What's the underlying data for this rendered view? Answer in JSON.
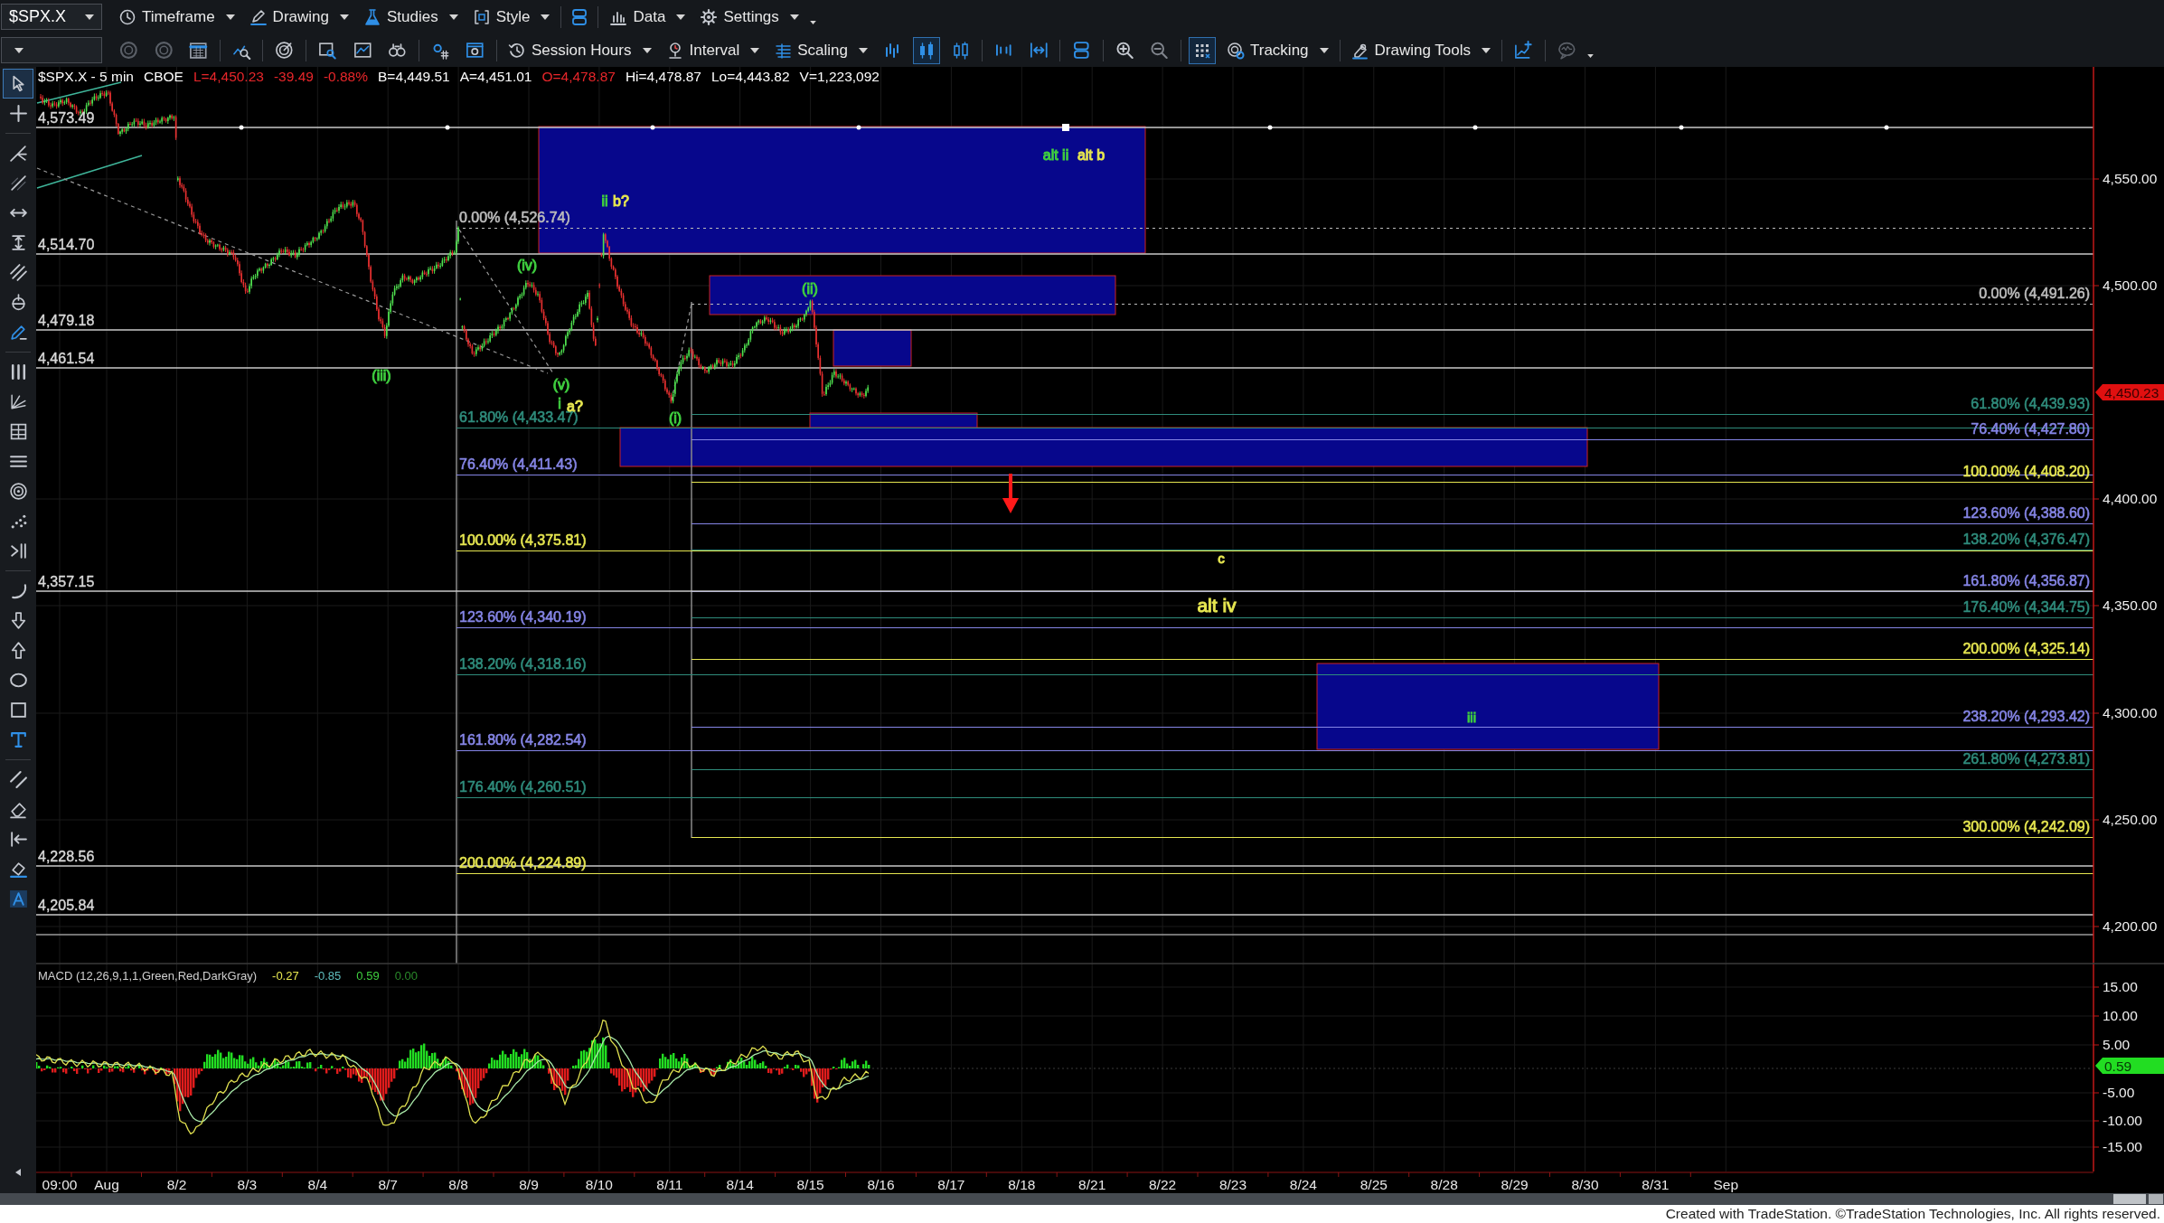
{
  "toolbar": {
    "symbol": "$SPX.X",
    "menus": [
      {
        "label": "Timeframe"
      },
      {
        "label": "Drawing"
      },
      {
        "label": "Studies"
      },
      {
        "label": "Style"
      },
      {
        "label": "Data"
      },
      {
        "label": "Settings"
      }
    ]
  },
  "toolbar_2": {
    "session_button": "Session Hours",
    "interval_button": "Interval",
    "scaling_button": "Scaling",
    "chart_styles": [
      {
        "selected": false
      },
      {
        "selected": true
      },
      {
        "selected": false
      }
    ],
    "grid_toggle": {
      "on": true
    },
    "tracking_button": "Tracking",
    "drawing_tools_button": "Drawing Tools"
  },
  "drawing_tools": [
    {
      "selected": true
    },
    {
      "selected": false
    },
    {
      "selected": false
    },
    {
      "selected": false
    },
    {
      "selected": false
    },
    {
      "selected": false
    },
    {
      "selected": false
    },
    {
      "selected": false
    },
    {
      "selected": false
    },
    {
      "selected": false
    },
    {
      "selected": false
    },
    {
      "selected": false
    },
    {
      "selected": false
    },
    {
      "selected": false
    },
    {
      "selected": false
    },
    {
      "selected": false
    },
    {
      "selected": false
    },
    {
      "selected": false
    },
    {
      "selected": false
    },
    {
      "selected": false
    },
    {
      "selected": false
    },
    {
      "selected": false
    },
    {
      "selected": false
    },
    {
      "selected": false
    },
    {
      "selected": false
    },
    {
      "selected": false
    },
    {
      "selected": false
    }
  ],
  "chart": {
    "quote": [
      {
        "text": "$SPX.X - 5 min",
        "color": "#ffffff"
      },
      {
        "text": "CBOE",
        "color": "#ffffff"
      },
      {
        "text": "L=4,450.23",
        "color": "#e8262a"
      },
      {
        "text": "-39.49",
        "color": "#e8262a"
      },
      {
        "text": "-0.88%",
        "color": "#e8262a"
      },
      {
        "text": "B=4,449.51",
        "color": "#ffffff"
      },
      {
        "text": "A=4,451.01",
        "color": "#ffffff"
      },
      {
        "text": "O=4,478.87",
        "color": "#e8262a"
      },
      {
        "text": "Hi=4,478.87",
        "color": "#ffffff"
      },
      {
        "text": "Lo=4,443.82",
        "color": "#ffffff"
      },
      {
        "text": "V=1,223,092",
        "color": "#ffffff"
      }
    ],
    "price_lines": [
      {
        "label": "4,573.49"
      },
      {
        "label": "4,514.70"
      },
      {
        "label": "4,479.18"
      },
      {
        "label": "4,461.54"
      },
      {
        "label": "4,357.15"
      },
      {
        "label": "4,228.56"
      },
      {
        "label": "4,205.84"
      }
    ],
    "fib_retracement": [
      {
        "label": "0.00% (4,526.74)",
        "color": "#bcbcbc",
        "kind": "base"
      },
      {
        "label": "61.80% (4,433.47)",
        "color": "#2f8c7c",
        "kind": "level"
      },
      {
        "label": "76.40% (4,411.43)",
        "color": "#8585e6",
        "kind": "level"
      },
      {
        "label": "100.00% (4,375.81)",
        "color": "#e6e650",
        "kind": "level"
      },
      {
        "label": "123.60% (4,340.19)",
        "color": "#8585e6",
        "kind": "level"
      },
      {
        "label": "138.20% (4,318.16)",
        "color": "#2f8c7c",
        "kind": "level"
      },
      {
        "label": "161.80% (4,282.54)",
        "color": "#8585e6",
        "kind": "level"
      },
      {
        "label": "176.40% (4,260.51)",
        "color": "#2f8c7c",
        "kind": "level"
      },
      {
        "label": "200.00% (4,224.89)",
        "color": "#e6e650",
        "kind": "level"
      }
    ],
    "fib_extension": [
      {
        "label": "0.00% (4,491.26)",
        "color": "#bcbcbc",
        "kind": "base"
      },
      {
        "label": "61.80% (4,439.93)",
        "color": "#2f8c7c",
        "kind": "level"
      },
      {
        "label": "76.40% (4,427.80)",
        "color": "#8585e6",
        "kind": "level"
      },
      {
        "label": "100.00% (4,408.20)",
        "color": "#e6e650",
        "kind": "level"
      },
      {
        "label": "123.60% (4,388.60)",
        "color": "#8585e6",
        "kind": "level"
      },
      {
        "label": "138.20% (4,376.47)",
        "color": "#2f8c7c",
        "kind": "level"
      },
      {
        "label": "161.80% (4,356.87)",
        "color": "#8585e6",
        "kind": "level"
      },
      {
        "label": "176.40% (4,344.75)",
        "color": "#2f8c7c",
        "kind": "level"
      },
      {
        "label": "200.00% (4,325.14)",
        "color": "#e6e650",
        "kind": "level"
      },
      {
        "label": "238.20% (4,293.42)",
        "color": "#8585e6",
        "kind": "level"
      },
      {
        "label": "261.80% (4,273.81)",
        "color": "#2f8c7c",
        "kind": "level"
      },
      {
        "label": "300.00% (4,242.09)",
        "color": "#e6e650",
        "kind": "level"
      }
    ],
    "wave_labels": [
      {
        "text": "alt ii",
        "color": "#3fcf3f"
      },
      {
        "text": "alt b",
        "color": "#e6e650"
      },
      {
        "text": "ii",
        "color": "#3fcf3f"
      },
      {
        "text": "b?",
        "color": "#e6e650"
      },
      {
        "text": "(iv)",
        "color": "#3fcf3f"
      },
      {
        "text": "(iii)",
        "color": "#3fcf3f"
      },
      {
        "text": "(v)",
        "color": "#3fcf3f"
      },
      {
        "text": "i",
        "color": "#3fcf3f"
      },
      {
        "text": "a?",
        "color": "#e6e650"
      },
      {
        "text": "(i)",
        "color": "#3fcf3f"
      },
      {
        "text": "(ii)",
        "color": "#3fcf3f"
      },
      {
        "text": "c",
        "color": "#e6e650"
      },
      {
        "text": "alt iv",
        "color": "#e6e650"
      },
      {
        "text": "iii",
        "color": "#3fcf3f"
      }
    ],
    "price_axis": {
      "labels": [
        "4,550.00",
        "4,500.00",
        "4,400.00",
        "4,350.00",
        "4,300.00",
        "4,250.00",
        "4,200.00"
      ],
      "last_price": "4,450.23"
    }
  },
  "macd": {
    "title": "MACD (12,26,9,1,1,Green,Red,DarkGray)",
    "values": [
      {
        "text": "-0.27",
        "color": "#e6e650"
      },
      {
        "text": "-0.85",
        "color": "#5fbfbf"
      },
      {
        "text": "0.59",
        "color": "#3fcf3f"
      },
      {
        "text": "0.00",
        "color": "#2a8a2a"
      }
    ],
    "axis": [
      "15.00",
      "10.00",
      "5.00",
      "-5.00",
      "-10.00",
      "-15.00"
    ],
    "last_value": "0.59"
  },
  "date_axis": [
    "09:00",
    "Aug",
    "8/2",
    "8/3",
    "8/4",
    "8/7",
    "8/8",
    "8/9",
    "8/10",
    "8/11",
    "8/14",
    "8/15",
    "8/16",
    "8/17",
    "8/18",
    "8/21",
    "8/22",
    "8/23",
    "8/24",
    "8/25",
    "8/28",
    "8/29",
    "8/30",
    "8/31",
    "Sep"
  ],
  "footer": "Created with TradeStation. ©TradeStation Technologies, Inc. All rights reserved."
}
